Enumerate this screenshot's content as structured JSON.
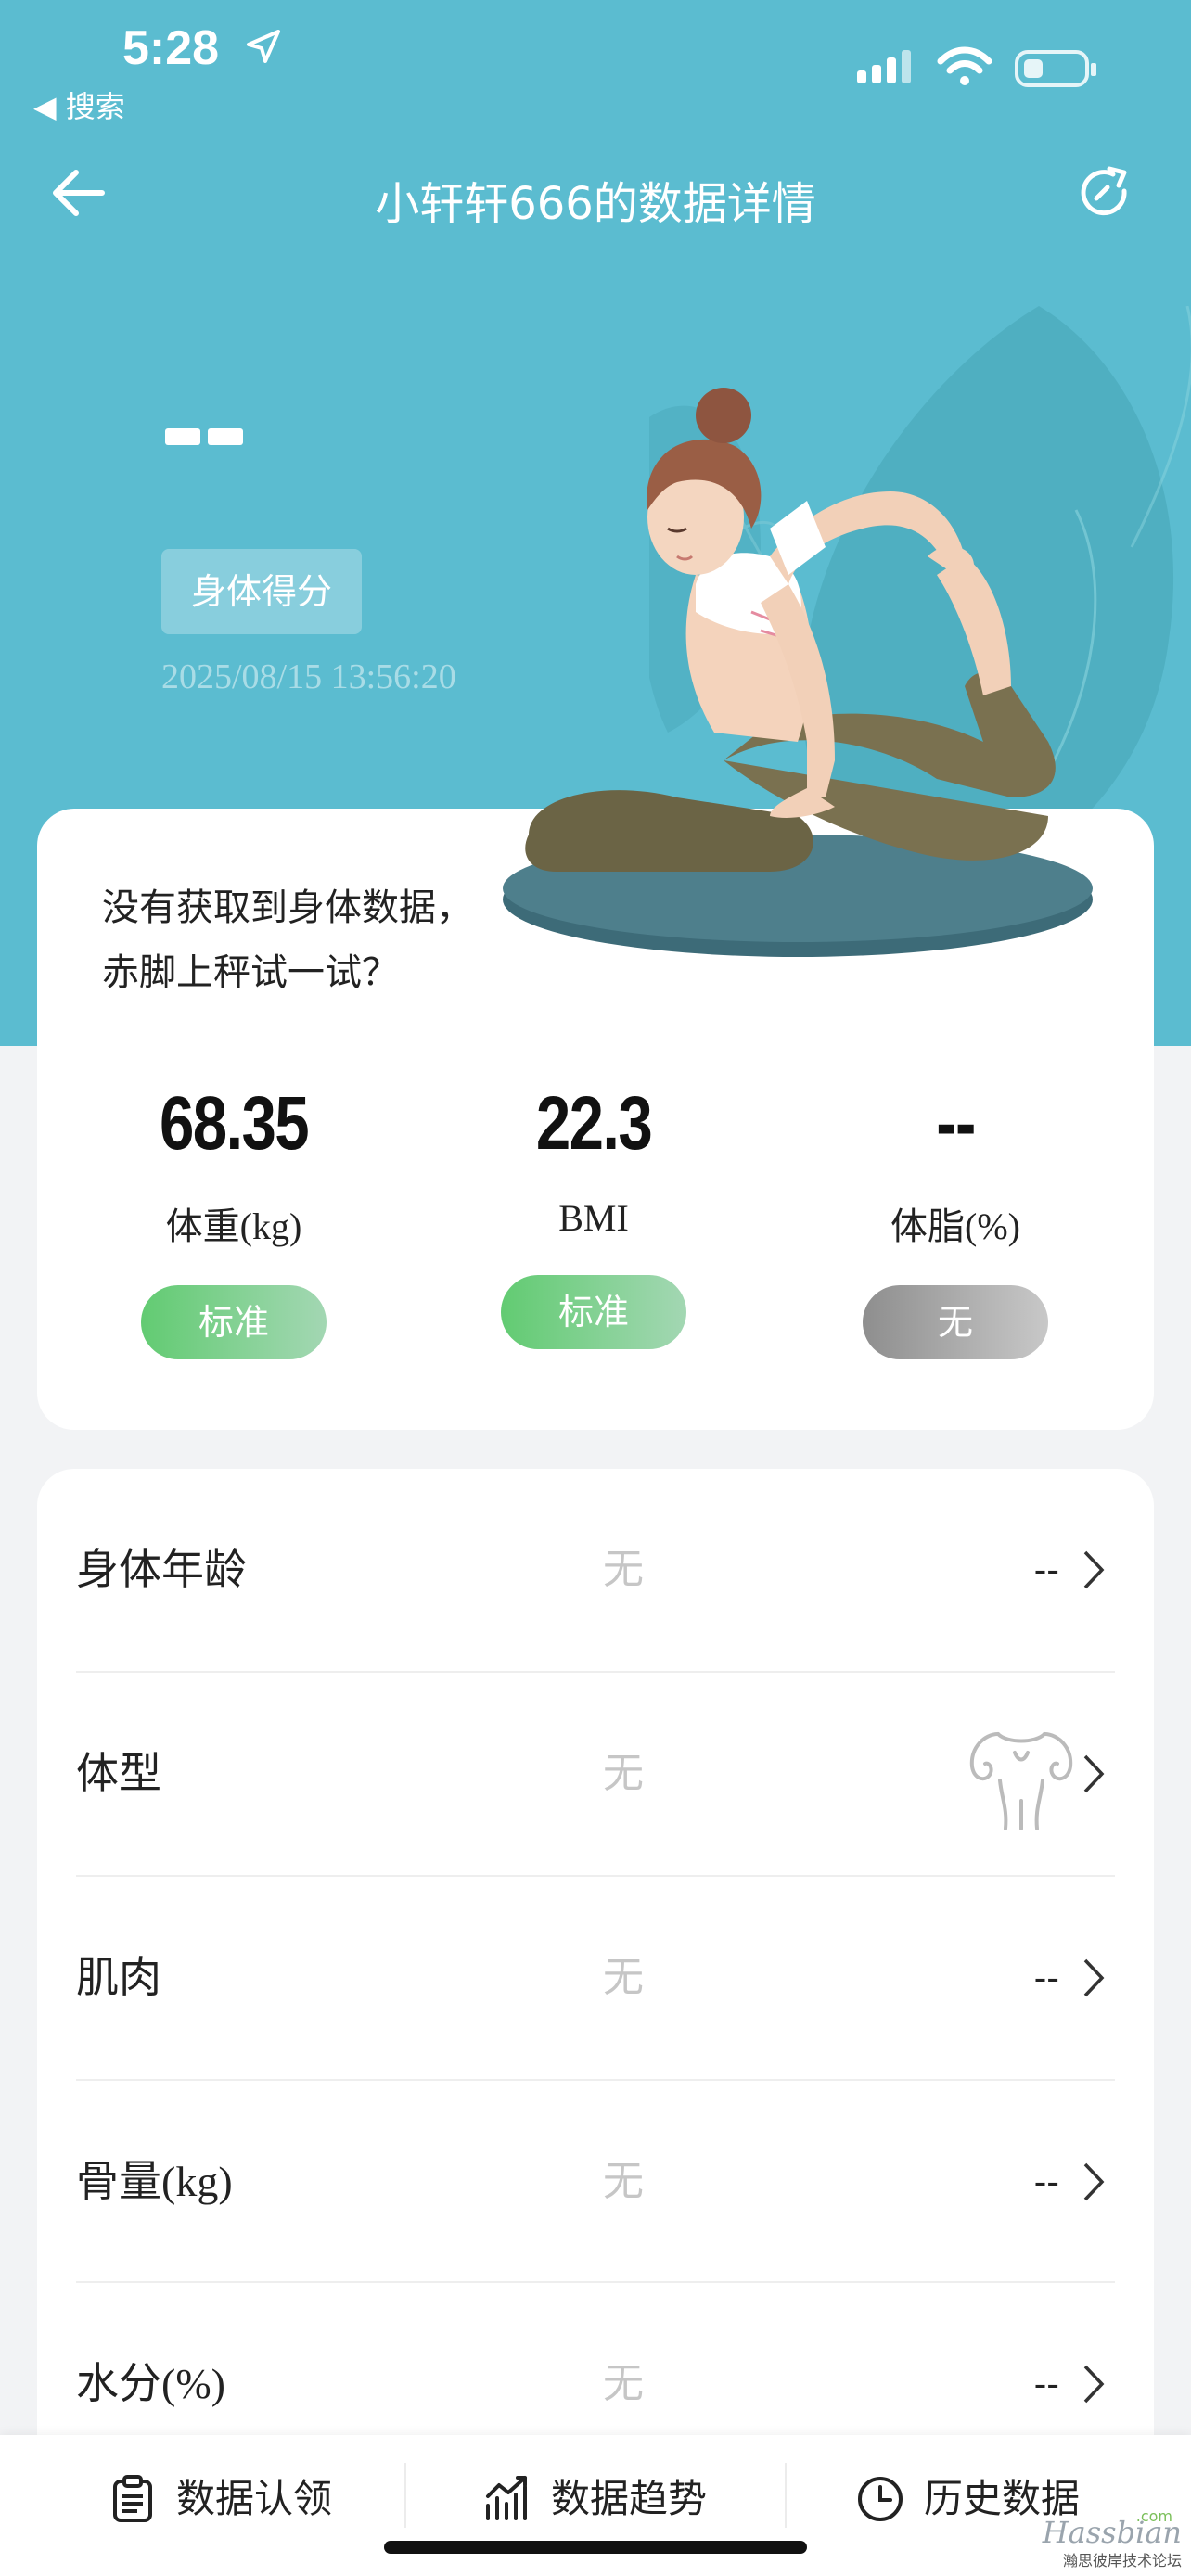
{
  "status_bar": {
    "time": "5:28",
    "back_app": "◀ 搜索"
  },
  "nav": {
    "title": "小轩轩666的数据详情"
  },
  "score": {
    "badge": "身体得分",
    "timestamp": "2025/08/15 13:56:20"
  },
  "card": {
    "message_line1": "没有获取到身体数据，",
    "message_line2": "赤脚上秤试一试？"
  },
  "metrics": [
    {
      "value": "68.35",
      "label": "体重(kg)",
      "status": "标准",
      "status_color": "green"
    },
    {
      "value": "22.3",
      "label": "BMI",
      "status": "标准",
      "status_color": "green"
    },
    {
      "value": "--",
      "label": "体脂(%)",
      "status": "无",
      "status_color": "gray"
    }
  ],
  "details": [
    {
      "label": "身体年龄",
      "level": "无",
      "value": "--"
    },
    {
      "label": "体型",
      "level": "无",
      "value": "",
      "icon": "body-shape-icon"
    },
    {
      "label": "肌肉",
      "level": "无",
      "value": "--"
    },
    {
      "label": "骨量(kg)",
      "level": "无",
      "value": "--"
    },
    {
      "label": "水分(%)",
      "level": "无",
      "value": "--"
    }
  ],
  "tabs": [
    {
      "label": "数据认领",
      "icon": "clipboard-icon"
    },
    {
      "label": "数据趋势",
      "icon": "trend-chart-icon"
    },
    {
      "label": "历史数据",
      "icon": "clock-icon"
    }
  ],
  "watermark": {
    "brand": "Hassbian",
    "domain": ".com",
    "subtitle": "瀚思彼岸技术论坛"
  },
  "colors": {
    "header_bg": "#5bbcd0",
    "pill_green": "#62cb72",
    "pill_gray": "#8e8e8e"
  }
}
